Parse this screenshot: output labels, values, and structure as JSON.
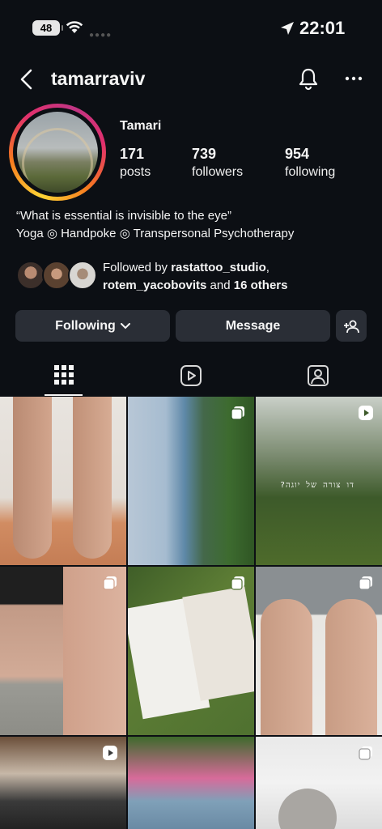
{
  "status_bar": {
    "battery": "48",
    "time": "22:01"
  },
  "header": {
    "username": "tamarraviv"
  },
  "profile": {
    "display_name": "Tamari",
    "stats": [
      {
        "value": "171",
        "label": "posts"
      },
      {
        "value": "739",
        "label": "followers"
      },
      {
        "value": "954",
        "label": "following"
      }
    ],
    "bio_line1": "“What is essential is invisible to the eye”",
    "bio_line2": "Yoga ◎ Handpoke ◎ Transpersonal Psychotherapy"
  },
  "followed_by": {
    "prefix": "Followed by ",
    "user1": "rastattoo_studio",
    "comma": ",",
    "user2": "rotem_yacobovits",
    "middle": " and ",
    "others": "16 others"
  },
  "actions": {
    "following_label": "Following",
    "message_label": "Message"
  },
  "tabs": [
    "grid-icon",
    "reels-icon",
    "tagged-icon"
  ],
  "posts": [
    {
      "kind": "image",
      "badge": "none"
    },
    {
      "kind": "image",
      "badge": "carousel"
    },
    {
      "kind": "video",
      "badge": "reel",
      "overlay_text": "?דו צורה של יוגה"
    },
    {
      "kind": "image",
      "badge": "carousel"
    },
    {
      "kind": "image",
      "badge": "carousel"
    },
    {
      "kind": "image",
      "badge": "carousel"
    },
    {
      "kind": "video",
      "badge": "reel"
    },
    {
      "kind": "image",
      "badge": "none"
    },
    {
      "kind": "image",
      "badge": "carousel"
    }
  ],
  "colors": {
    "background": "#0c0f14",
    "button": "#2a2e36",
    "ring_start": "#fdd435",
    "ring_end": "#c13584"
  }
}
